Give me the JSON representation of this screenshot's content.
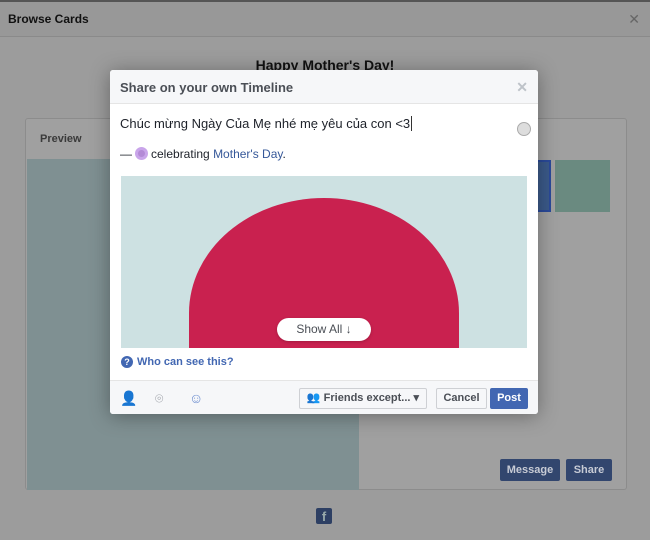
{
  "background": {
    "title": "Browse Cards",
    "heading": "Happy Mother's Day!",
    "preview_label": "Preview",
    "message_button": "Message",
    "share_button": "Share"
  },
  "dialog": {
    "title": "Share on your own Timeline",
    "message": "Chúc mừng Ngày Của Mẹ nhé mẹ yêu của con <3",
    "celebrating_prefix": "—",
    "celebrating_text": "celebrating",
    "celebrating_link": "Mother's Day",
    "celebrating_suffix": ".",
    "show_all": "Show All ↓",
    "who_can_see": "Who can see this?",
    "audience": "Friends except...",
    "cancel": "Cancel",
    "post": "Post"
  },
  "colors": {
    "accent": "#4267b2",
    "link": "#365899"
  }
}
